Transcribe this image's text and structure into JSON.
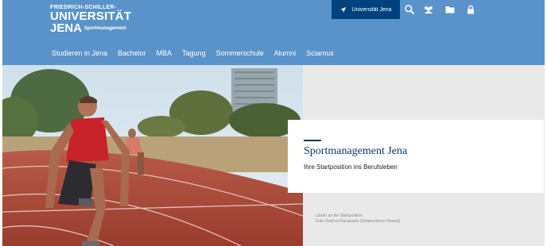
{
  "logo": {
    "line1": "FRIEDRICH-SCHILLER-",
    "line2": "UNIVERSITÄT",
    "line3": "JENA",
    "subtitle": "Sportmanagement"
  },
  "toolbar": {
    "university_button": "Universität Jena",
    "icons": [
      "navigation-arrow-icon",
      "search-icon",
      "user-group-icon",
      "folder-icon",
      "lock-icon"
    ]
  },
  "nav": {
    "items": [
      "Studieren in Jena",
      "Bachelor",
      "MBA",
      "Tagung",
      "Sommerschule",
      "Alumni",
      "Sciamus"
    ]
  },
  "hero": {
    "title": "Sportmanagement Jena",
    "subtitle": "Ihre Startposition ins Berufsleben",
    "credit_line1": "Läufer an der Startposition",
    "credit_line2": "Foto: Andrea Piacquadio (Unternehmen Pexels)"
  },
  "colors": {
    "header_bg": "#5a93c9",
    "accent_dark_blue": "#00427d",
    "title_blue": "#0a3a6a"
  }
}
